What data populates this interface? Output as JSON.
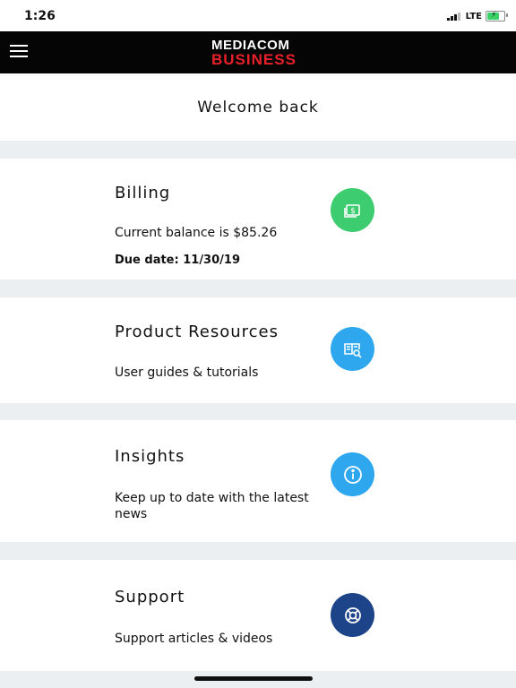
{
  "status": {
    "time": "1:26",
    "network": "LTE"
  },
  "header": {
    "logo_top": "MEDIACOM",
    "logo_bottom": "BUSINESS",
    "menu_icon": "hamburger-menu-icon"
  },
  "welcome": {
    "text": "Welcome back"
  },
  "cards": {
    "billing": {
      "title": "Billing",
      "balance": "Current balance is $85.26",
      "due": "Due date: 11/30/19",
      "icon": "money-bill-icon",
      "color": "#3dcc6f"
    },
    "resources": {
      "title": "Product Resources",
      "subtitle": "User guides & tutorials",
      "icon": "book-search-icon",
      "color": "#2ea7ee"
    },
    "insights": {
      "title": "Insights",
      "subtitle": "Keep up to date with the latest news",
      "icon": "info-icon",
      "color": "#2ea7ee"
    },
    "support": {
      "title": "Support",
      "subtitle": "Support articles & videos",
      "icon": "lifebuoy-icon",
      "color": "#1d4389"
    }
  }
}
